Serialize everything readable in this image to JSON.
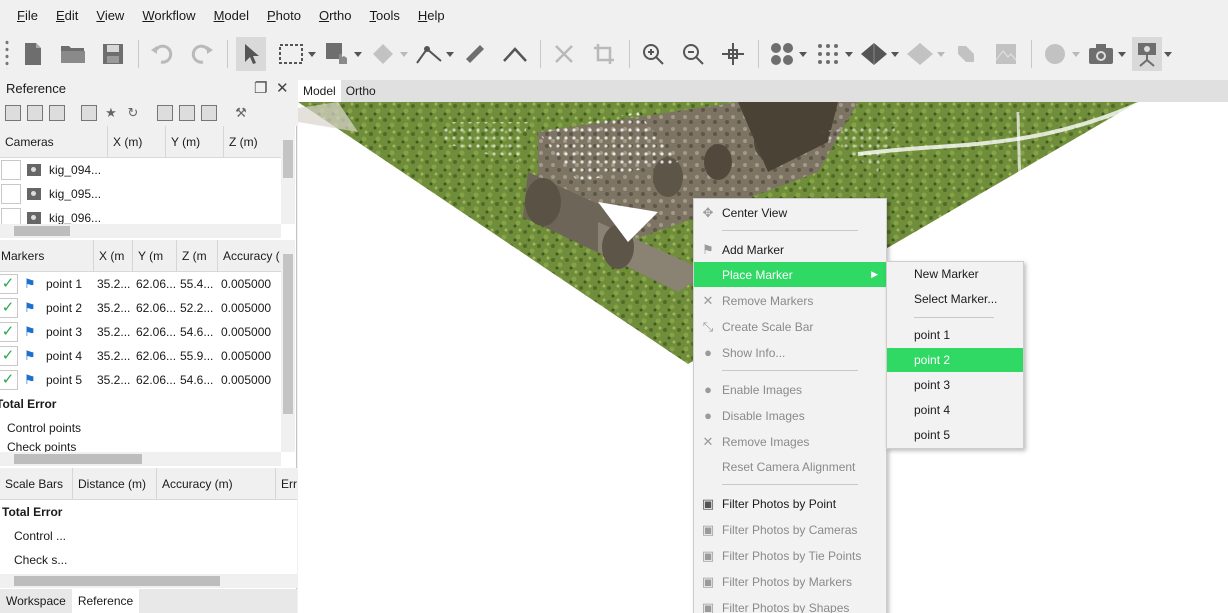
{
  "menubar": {
    "items": [
      {
        "label": "File",
        "u": "F"
      },
      {
        "label": "Edit",
        "u": "E"
      },
      {
        "label": "View",
        "u": "V"
      },
      {
        "label": "Workflow",
        "u": "W"
      },
      {
        "label": "Model",
        "u": "M"
      },
      {
        "label": "Photo",
        "u": "P"
      },
      {
        "label": "Ortho",
        "u": "O"
      },
      {
        "label": "Tools",
        "u": "T"
      },
      {
        "label": "Help",
        "u": "H"
      }
    ]
  },
  "reference_panel": {
    "title": "Reference",
    "cameras": {
      "headers": [
        "Cameras",
        "X (m)",
        "Y (m)",
        "Z (m)"
      ],
      "rows": [
        "kig_094...",
        "kig_095...",
        "kig_096..."
      ]
    },
    "markers": {
      "headers": [
        "Markers",
        "X (m",
        "Y (m",
        "Z (m",
        "Accuracy ("
      ],
      "rows": [
        {
          "name": "point 1",
          "x": "35.2...",
          "y": "62.06...",
          "z": "55.4...",
          "acc": "0.005000"
        },
        {
          "name": "point 2",
          "x": "35.2...",
          "y": "62.06...",
          "z": "52.2...",
          "acc": "0.005000"
        },
        {
          "name": "point 3",
          "x": "35.2...",
          "y": "62.06...",
          "z": "54.6...",
          "acc": "0.005000"
        },
        {
          "name": "point 4",
          "x": "35.2...",
          "y": "62.06...",
          "z": "55.9...",
          "acc": "0.005000"
        },
        {
          "name": "point 5",
          "x": "35.2...",
          "y": "62.06...",
          "z": "54.6...",
          "acc": "0.005000"
        }
      ],
      "total_error": "Total Error",
      "control_points": "Control points",
      "check_points": "Check points"
    },
    "scalebars": {
      "headers": [
        "Scale Bars",
        "Distance (m)",
        "Accuracy (m)",
        "Err"
      ],
      "total_error": "Total Error",
      "control": "Control ...",
      "check": "Check s..."
    },
    "tabs": [
      "Workspace",
      "Reference"
    ]
  },
  "viewport": {
    "tabs": [
      "Model",
      "Ortho"
    ]
  },
  "context_menu": {
    "center_view": "Center View",
    "add_marker": "Add Marker",
    "place_marker": "Place Marker",
    "remove_markers": "Remove Markers",
    "create_scale_bar": "Create Scale Bar",
    "show_info": "Show Info...",
    "enable_images": "Enable Images",
    "disable_images": "Disable Images",
    "remove_images": "Remove Images",
    "reset_camera_alignment": "Reset Camera Alignment",
    "filter_by_point": "Filter Photos by Point",
    "filter_by_cameras": "Filter Photos by Cameras",
    "filter_by_tie_points": "Filter Photos by Tie Points",
    "filter_by_markers": "Filter Photos by Markers",
    "filter_by_shapes": "Filter Photos by Shapes"
  },
  "submenu": {
    "new_marker": "New Marker",
    "select_marker": "Select Marker...",
    "points": [
      "point 1",
      "point 2",
      "point 3",
      "point 4",
      "point 5"
    ]
  },
  "colors": {
    "highlight": "#2fd964",
    "check": "#2ba84a",
    "flag": "#1f6fd0"
  }
}
